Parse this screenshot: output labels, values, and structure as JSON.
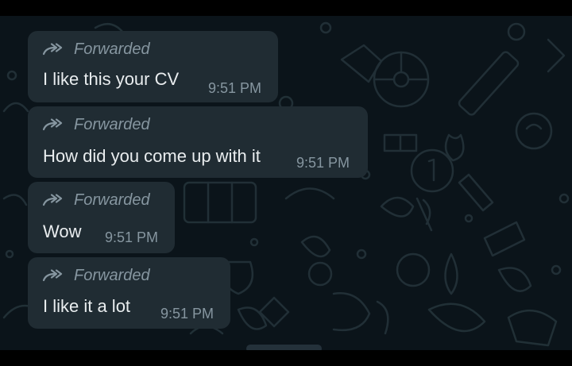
{
  "messages": [
    {
      "forward_label": "Forwarded",
      "text": "I like this your CV",
      "time": "9:51 PM"
    },
    {
      "forward_label": "Forwarded",
      "text": "How did you come up with it",
      "time": "9:51 PM"
    },
    {
      "forward_label": "Forwarded",
      "text": "Wow",
      "time": "9:51 PM"
    },
    {
      "forward_label": "Forwarded",
      "text": "I like it a lot",
      "time": "9:51 PM"
    }
  ],
  "colors": {
    "chat_background": "#0b141a",
    "bubble_background": "#202c33",
    "message_text": "#e9edef",
    "meta_text": "#8696a0"
  },
  "icons": {
    "forward": "forward-arrow-icon",
    "wallpaper": "doodle-pattern"
  }
}
